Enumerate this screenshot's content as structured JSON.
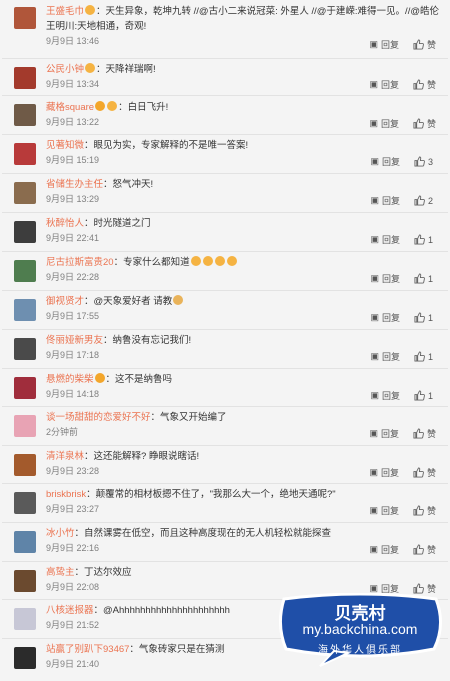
{
  "reply_label": "回复",
  "like_label": "赞",
  "comments": [
    {
      "user": "王盛毛巾",
      "text": "：天生异象，乾坤九转 //@古小二来说冠菜: 外星人 //@于建嵘:难得一见。//@皓伦王明川:天地相通，奇观!",
      "time": "9月9日 13:46",
      "like": "赞",
      "avatar": "#b0563a"
    },
    {
      "user": "公民小钟",
      "text": "：天降祥瑞啊!",
      "time": "9月9日 13:34",
      "like": "赞",
      "avatar": "#a33a2c"
    },
    {
      "user": "藏格square",
      "text": "：白日飞升!",
      "time": "9月9日 13:22",
      "like": "赞",
      "avatar": "#6f5a47"
    },
    {
      "user": "见著知微",
      "text": "：眼见为实，专家解释的不是唯一答案!",
      "time": "9月9日 15:19",
      "like": "3",
      "avatar": "#b83a3a"
    },
    {
      "user": "省储生办主任",
      "text": "：怒气冲天!",
      "time": "9月9日 13:29",
      "like": "2",
      "avatar": "#8a6c4e"
    },
    {
      "user": "秋醉怡人",
      "text": "：时光隧道之门",
      "time": "9月9日 22:41",
      "like": "1",
      "avatar": "#3d3d3d"
    },
    {
      "user": "尼古拉斯富贵20",
      "text": "：专家什么都知道",
      "time": "9月9日 22:28",
      "like": "1",
      "avatar": "#4f7d4f"
    },
    {
      "user": "御视贤才",
      "text": "：@天象爱好者 请教",
      "time": "9月9日 17:55",
      "like": "1",
      "avatar": "#6e8fb0"
    },
    {
      "user": "佟丽娅新男友",
      "text": "：纳鲁没有忘记我们!",
      "time": "9月9日 17:18",
      "like": "1",
      "avatar": "#4a4a4a"
    },
    {
      "user": "悬燃的柴柴",
      "text": "：这不是纳鲁吗",
      "time": "9月9日 14:18",
      "like": "1",
      "avatar": "#a02d3c"
    },
    {
      "user": "谈一场甜甜的恋爱好不好",
      "text": "：气象又开始编了",
      "time": "2分钟前",
      "like": "赞",
      "avatar": "#e8a3b4"
    },
    {
      "user": "清洋泉林",
      "text": "：这还能解释? 睁眼说瞎话!",
      "time": "9月9日 23:28",
      "like": "赞",
      "avatar": "#a35a2c"
    },
    {
      "user": "briskbrisk",
      "text": "：颠覆常的相材板摁不住了，\"我那么大一个，绝地天通呢?\"",
      "time": "9月9日 23:27",
      "like": "赞",
      "avatar": "#5a5a5a"
    },
    {
      "user": "冰小竹",
      "text": "：自然课雾在低空，而且这种高度现在的无人机轻松就能探查",
      "time": "9月9日 22:16",
      "like": "赞",
      "avatar": "#5f84a8"
    },
    {
      "user": "高鸷主",
      "text": "：丁达尔效应",
      "time": "9月9日 22:08",
      "like": "赞",
      "avatar": "#6b4a2f"
    },
    {
      "user": "八核迷报器",
      "text": "：@Ahhhhhhhhhhhhhhhhhhhhh",
      "time": "9月9日 21:52",
      "like": "赞",
      "avatar": "#c7c7d6"
    },
    {
      "user": "站赢了别趴下93467",
      "text": "：气象砖家只是在猜测",
      "time": "9月9日 21:40",
      "like": "赞",
      "avatar": "#2b2b2b"
    }
  ],
  "watermark": {
    "title": "贝壳村",
    "url": "my.backchina.com",
    "subtitle": "海外华人俱乐部",
    "bg": "#1f4fa8",
    "border": "#ffffff"
  }
}
